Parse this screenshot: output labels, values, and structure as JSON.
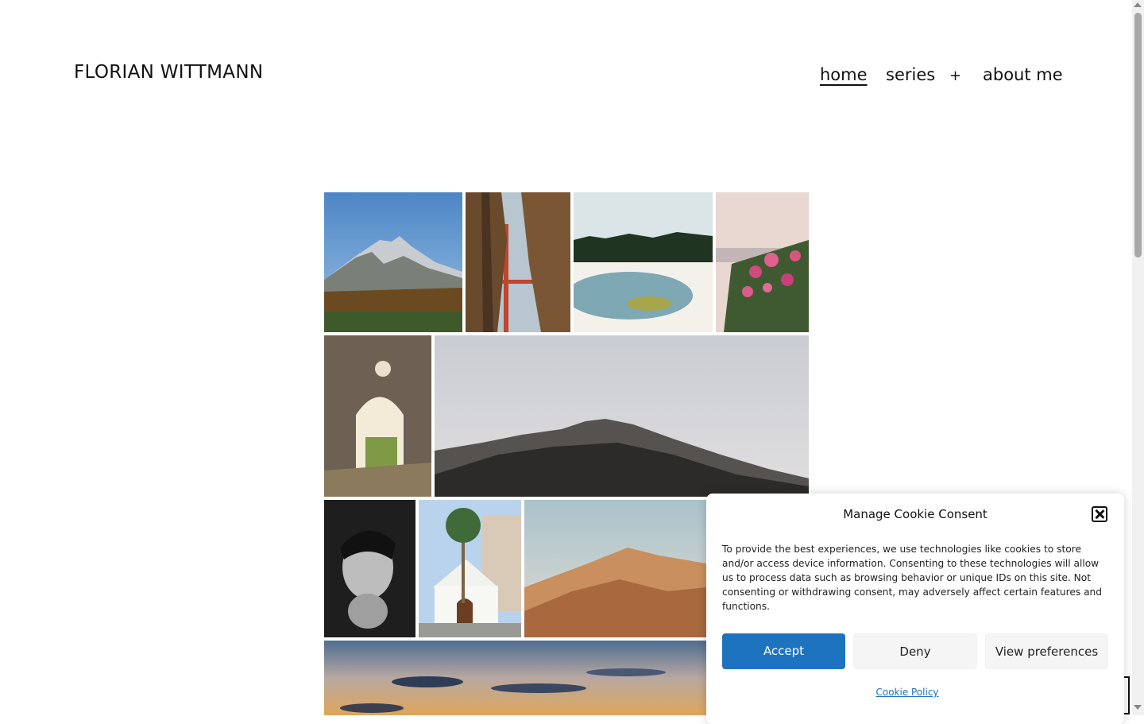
{
  "site": {
    "title": "FLORIAN WITTMANN"
  },
  "nav": {
    "items": [
      {
        "label": "home",
        "current": true
      },
      {
        "label": "series"
      },
      {
        "label": "+",
        "type": "submenu-toggle"
      },
      {
        "label": "about me"
      }
    ]
  },
  "gallery": {
    "photos": [
      {
        "subject": "mountain with autumn forest"
      },
      {
        "subject": "golden gate bridge through tree trunks"
      },
      {
        "subject": "lake with snow and forest"
      },
      {
        "subject": "pink oleander flowers by the sea"
      },
      {
        "subject": "stone ruin archway"
      },
      {
        "subject": "mountain ridge silhouette"
      },
      {
        "subject": "black and white portrait"
      },
      {
        "subject": "white church with palm trees"
      },
      {
        "subject": "desert mountains"
      },
      {
        "subject": "sunset sky with clouds"
      }
    ]
  },
  "cookie_banner": {
    "title": "Manage Cookie Consent",
    "body": "To provide the best experiences, we use technologies like cookies to store and/or access device information. Consenting to these technologies will allow us to process data such as browsing behavior or unique IDs on this site. Not consenting or withdrawing consent, may adversely affect certain features and functions.",
    "accept_label": "Accept",
    "deny_label": "Deny",
    "preferences_label": "View preferences",
    "policy_link": "Cookie Policy"
  },
  "colors": {
    "accent": "#1e73be",
    "text": "#111111",
    "background": "#ffffff"
  }
}
